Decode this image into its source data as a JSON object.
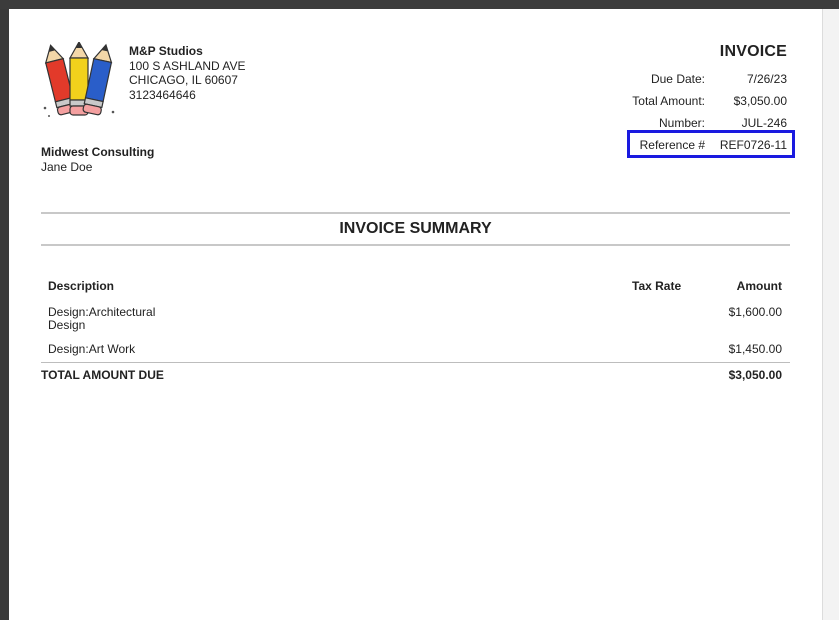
{
  "company": {
    "name": "M&P Studios",
    "address1": "100 S ASHLAND AVE",
    "address2": "CHICAGO, IL 60607",
    "phone": "3123464646"
  },
  "invoice": {
    "title": "INVOICE",
    "fields": [
      {
        "label": "Due Date:",
        "value": "7/26/23"
      },
      {
        "label": "Total Amount:",
        "value": "$3,050.00"
      },
      {
        "label": "Number:",
        "value": "JUL-246"
      },
      {
        "label": "Reference #",
        "value": "REF0726-11"
      }
    ]
  },
  "bill_to": {
    "client": "Midwest Consulting",
    "contact": "Jane Doe"
  },
  "summary": {
    "title": "INVOICE SUMMARY",
    "headers": {
      "description": "Description",
      "tax_rate": "Tax Rate",
      "amount": "Amount"
    },
    "items": [
      {
        "description": "Design:Architectural Design",
        "tax_rate": "",
        "amount": "$1,600.00"
      },
      {
        "description": "Design:Art Work",
        "tax_rate": "",
        "amount": "$1,450.00"
      }
    ],
    "total_label": "TOTAL AMOUNT DUE",
    "total_value": "$3,050.00"
  },
  "colors": {
    "highlight_box": "#1a1ae0",
    "rule": "#c8c8c8"
  },
  "logo_icon": "colored-pencils-icon"
}
